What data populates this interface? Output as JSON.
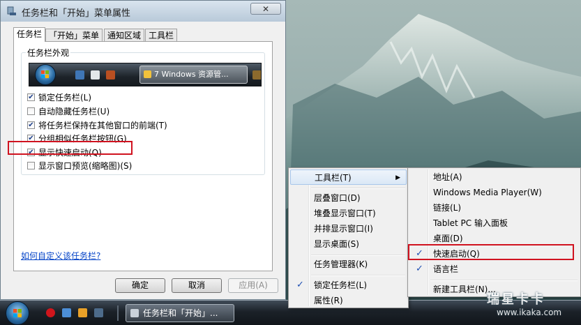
{
  "dialog": {
    "title": "任务栏和「开始」菜单属性",
    "close_label": "✕",
    "tabs": [
      "任务栏",
      "「开始」菜单",
      "通知区域",
      "工具栏"
    ],
    "active_tab": 0,
    "group_label": "任务栏外观",
    "preview_task_label": "7 Windows 资源管...",
    "options": [
      {
        "label": "锁定任务栏(L)",
        "checked": true
      },
      {
        "label": "自动隐藏任务栏(U)",
        "checked": false
      },
      {
        "label": "将任务栏保持在其他窗口的前端(T)",
        "checked": true
      },
      {
        "label": "分组相似任务栏按钮(G)",
        "checked": true
      },
      {
        "label": "显示快速启动(Q)",
        "checked": true
      },
      {
        "label": "显示窗口预览(缩略图)(S)",
        "checked": false
      }
    ],
    "help_link": "如何自定义该任务栏?",
    "buttons": {
      "ok": "确定",
      "cancel": "取消",
      "apply": "应用(A)"
    }
  },
  "context_menu": {
    "items": [
      {
        "label": "工具栏(T)",
        "submenu": true,
        "checked": false
      },
      {
        "label": "层叠窗口(D)",
        "checked": false
      },
      {
        "label": "堆叠显示窗口(T)",
        "checked": false
      },
      {
        "label": "并排显示窗口(I)",
        "checked": false
      },
      {
        "label": "显示桌面(S)",
        "checked": false
      },
      {
        "label": "任务管理器(K)",
        "checked": false
      },
      {
        "label": "锁定任务栏(L)",
        "checked": true
      },
      {
        "label": "属性(R)",
        "checked": false
      }
    ]
  },
  "toolbar_submenu": {
    "items": [
      {
        "label": "地址(A)",
        "checked": false
      },
      {
        "label": "Windows Media Player(W)",
        "checked": false
      },
      {
        "label": "链接(L)",
        "checked": false
      },
      {
        "label": "Tablet PC 输入面板",
        "checked": false
      },
      {
        "label": "桌面(D)",
        "checked": false
      },
      {
        "label": "快速启动(Q)",
        "checked": true
      },
      {
        "label": "语言栏",
        "checked": true
      },
      {
        "label": "新建工具栏(N)...",
        "checked": false
      }
    ]
  },
  "taskbar": {
    "task_label": "任务栏和「开始」..."
  },
  "watermark": {
    "brand": "瑞星卡卡",
    "url": "www.ikaka.com"
  },
  "colors": {
    "highlight_box": "#d0121f",
    "check_mark": "#1e4fb3",
    "link": "#0645c8"
  }
}
